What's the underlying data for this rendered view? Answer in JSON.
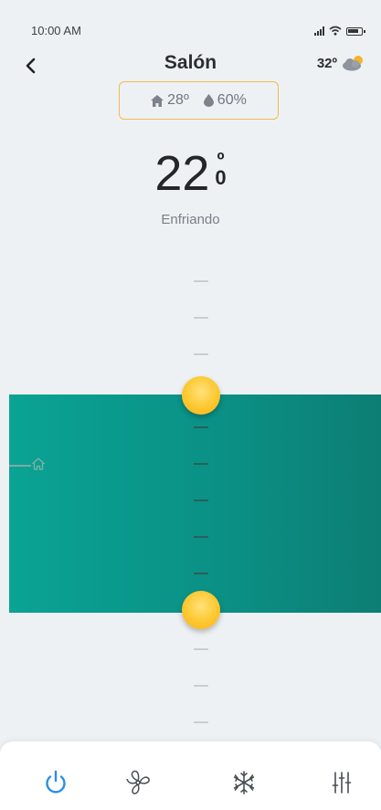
{
  "status_bar": {
    "time": "10:00 AM",
    "icons": [
      "signal-icon",
      "wifi-icon",
      "battery-icon"
    ]
  },
  "header": {
    "back_icon": "chevron-left-icon",
    "title": "Salón",
    "weather_temp": "32º",
    "weather_icon": "partly-cloudy-icon"
  },
  "room_info": {
    "indoor_temp": "28º",
    "indoor_temp_icon": "home-icon",
    "humidity": "60%",
    "humidity_icon": "droplet-icon",
    "border_color": "#f1bc4f"
  },
  "thermostat": {
    "setpoint": "22",
    "unit_top": "º",
    "unit_bottom": "0",
    "mode": "Enfriando"
  },
  "slider": {
    "band_color": "#0b8f84",
    "knob_color": "#fdc72f",
    "marker_icon": "home-icon"
  },
  "bottom_nav": {
    "items": [
      {
        "icon": "power-icon",
        "active": true
      },
      {
        "icon": "fan-icon",
        "active": false
      },
      {
        "icon": "snowflake-icon",
        "active": false
      },
      {
        "icon": "sliders-icon",
        "active": false
      }
    ],
    "active_color": "#2b8fe0"
  }
}
